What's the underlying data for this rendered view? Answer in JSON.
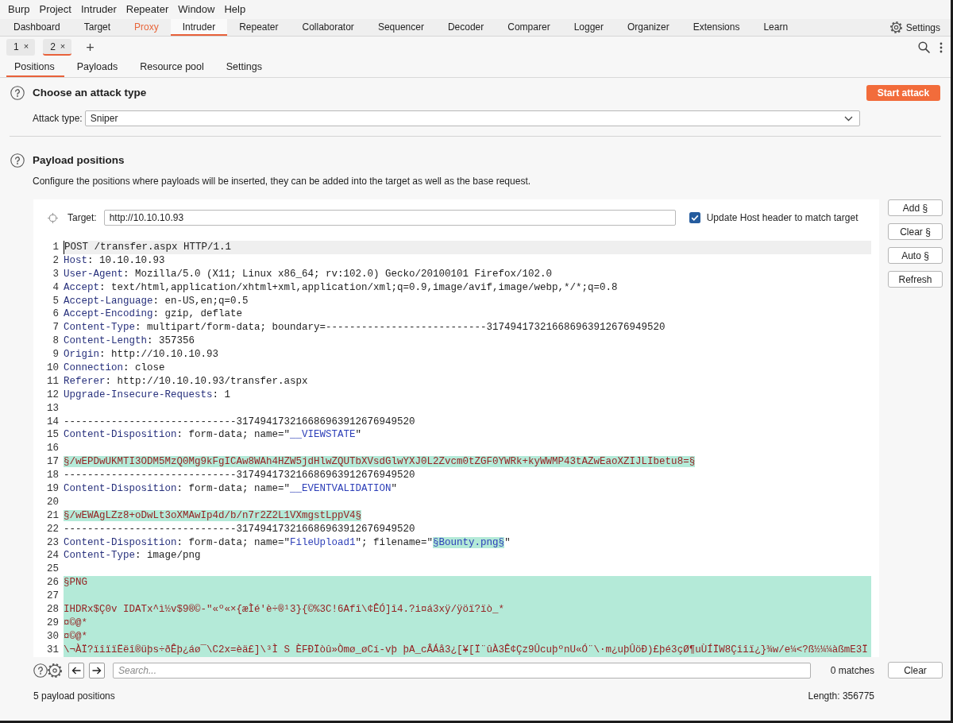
{
  "menu_bar": [
    "Burp",
    "Project",
    "Intruder",
    "Repeater",
    "Window",
    "Help"
  ],
  "main_tabs": [
    {
      "label": "Dashboard",
      "selected": false,
      "alert": false
    },
    {
      "label": "Target",
      "selected": false,
      "alert": false
    },
    {
      "label": "Proxy",
      "selected": false,
      "alert": true
    },
    {
      "label": "Intruder",
      "selected": true,
      "alert": false
    },
    {
      "label": "Repeater",
      "selected": false,
      "alert": false
    },
    {
      "label": "Collaborator",
      "selected": false,
      "alert": false
    },
    {
      "label": "Sequencer",
      "selected": false,
      "alert": false
    },
    {
      "label": "Decoder",
      "selected": false,
      "alert": false
    },
    {
      "label": "Comparer",
      "selected": false,
      "alert": false
    },
    {
      "label": "Logger",
      "selected": false,
      "alert": false
    },
    {
      "label": "Organizer",
      "selected": false,
      "alert": false
    },
    {
      "label": "Extensions",
      "selected": false,
      "alert": false
    },
    {
      "label": "Learn",
      "selected": false,
      "alert": false
    }
  ],
  "settings_button": "Settings",
  "request_tabs": [
    {
      "label": "1",
      "close": "×",
      "selected": false
    },
    {
      "label": "2",
      "close": "×",
      "selected": true
    }
  ],
  "new_tab": "+",
  "sub_tabs": [
    {
      "label": "Positions",
      "selected": true
    },
    {
      "label": "Payloads",
      "selected": false
    },
    {
      "label": "Resource pool",
      "selected": false
    },
    {
      "label": "Settings",
      "selected": false
    }
  ],
  "attack_section": {
    "title": "Choose an attack type",
    "start_button": "Start attack",
    "attack_type_label": "Attack type:",
    "attack_type": "Sniper"
  },
  "positions_section": {
    "title": "Payload positions",
    "description": "Configure the positions where payloads will be inserted, they can be added into the target as well as the base request.",
    "target_label": "Target:",
    "target": "http://10.10.10.93",
    "update_host_header": {
      "label": "Update Host header to match target",
      "checked": true
    },
    "side_buttons": [
      "Add §",
      "Clear §",
      "Auto §",
      "Refresh"
    ],
    "editor_lines": [
      {
        "number": "1",
        "current": true,
        "payload_block": false,
        "segments": [
          {
            "kind": "plain",
            "text": "POST /transfer.aspx HTTP/1.1"
          }
        ]
      },
      {
        "number": "2",
        "current": false,
        "payload_block": false,
        "segments": [
          {
            "kind": "name",
            "text": "Host"
          },
          {
            "kind": "plain",
            "text": ": 10.10.10.93"
          }
        ]
      },
      {
        "number": "3",
        "current": false,
        "payload_block": false,
        "segments": [
          {
            "kind": "name",
            "text": "User-Agent"
          },
          {
            "kind": "plain",
            "text": ": Mozilla/5.0 (X11; Linux x86_64; rv:102.0) Gecko/20100101 Firefox/102.0"
          }
        ]
      },
      {
        "number": "4",
        "current": false,
        "payload_block": false,
        "segments": [
          {
            "kind": "name",
            "text": "Accept"
          },
          {
            "kind": "plain",
            "text": ": text/html,application/xhtml+xml,application/xml;q=0.9,image/avif,image/webp,*/*;q=0.8"
          }
        ]
      },
      {
        "number": "5",
        "current": false,
        "payload_block": false,
        "segments": [
          {
            "kind": "name",
            "text": "Accept-Language"
          },
          {
            "kind": "plain",
            "text": ": en-US,en;q=0.5"
          }
        ]
      },
      {
        "number": "6",
        "current": false,
        "payload_block": false,
        "segments": [
          {
            "kind": "name",
            "text": "Accept-Encoding"
          },
          {
            "kind": "plain",
            "text": ": gzip, deflate"
          }
        ]
      },
      {
        "number": "7",
        "current": false,
        "payload_block": false,
        "segments": [
          {
            "kind": "name",
            "text": "Content-Type"
          },
          {
            "kind": "plain",
            "text": ": multipart/form-data; boundary=---------------------------317494173216686963912676949520"
          }
        ]
      },
      {
        "number": "8",
        "current": false,
        "payload_block": false,
        "segments": [
          {
            "kind": "name",
            "text": "Content-Length"
          },
          {
            "kind": "plain",
            "text": ": 357356"
          }
        ]
      },
      {
        "number": "9",
        "current": false,
        "payload_block": false,
        "segments": [
          {
            "kind": "name",
            "text": "Origin"
          },
          {
            "kind": "plain",
            "text": ": http://10.10.10.93"
          }
        ]
      },
      {
        "number": "10",
        "current": false,
        "payload_block": false,
        "segments": [
          {
            "kind": "name",
            "text": "Connection"
          },
          {
            "kind": "plain",
            "text": ": close"
          }
        ]
      },
      {
        "number": "11",
        "current": false,
        "payload_block": false,
        "segments": [
          {
            "kind": "name",
            "text": "Referer"
          },
          {
            "kind": "plain",
            "text": ": http://10.10.10.93/transfer.aspx"
          }
        ]
      },
      {
        "number": "12",
        "current": false,
        "payload_block": false,
        "segments": [
          {
            "kind": "name",
            "text": "Upgrade-Insecure-Requests"
          },
          {
            "kind": "plain",
            "text": ": 1"
          }
        ]
      },
      {
        "number": "13",
        "current": false,
        "payload_block": false
      },
      {
        "number": "14",
        "current": false,
        "payload_block": false,
        "segments": [
          {
            "kind": "plain",
            "text": "-----------------------------317494173216686963912676949520"
          }
        ]
      },
      {
        "number": "15",
        "current": false,
        "payload_block": false,
        "segments": [
          {
            "kind": "name",
            "text": "Content-Disposition"
          },
          {
            "kind": "plain",
            "text": ": form-data; name=\""
          },
          {
            "kind": "string",
            "text": "__VIEWSTATE"
          },
          {
            "kind": "plain",
            "text": "\""
          }
        ]
      },
      {
        "number": "16",
        "current": false,
        "payload_block": false
      },
      {
        "number": "17",
        "current": false,
        "payload_block": false,
        "segments": [
          {
            "kind": "payload",
            "text": "§/wEPDwUKMTI3ODM5MzQ0Mg9kFgICAw8WAh4HZW5jdHlwZQUTbXVsdGlwYXJ0L2Zvcm0tZGF0YWRk+kyWWMP43tAZwEaoXZIJLIbetu8=§"
          }
        ]
      },
      {
        "number": "18",
        "current": false,
        "payload_block": false,
        "segments": [
          {
            "kind": "plain",
            "text": "-----------------------------317494173216686963912676949520"
          }
        ]
      },
      {
        "number": "19",
        "current": false,
        "payload_block": false,
        "segments": [
          {
            "kind": "name",
            "text": "Content-Disposition"
          },
          {
            "kind": "plain",
            "text": ": form-data; name=\""
          },
          {
            "kind": "string",
            "text": "__EVENTVALIDATION"
          },
          {
            "kind": "plain",
            "text": "\""
          }
        ]
      },
      {
        "number": "20",
        "current": false,
        "payload_block": false
      },
      {
        "number": "21",
        "current": false,
        "payload_block": false,
        "segments": [
          {
            "kind": "payload",
            "text": "§/wEWAgLZz8+oDwLt3oXMAwIp4d/b/n7r2Z2L1VXmgstLppV4§"
          }
        ]
      },
      {
        "number": "22",
        "current": false,
        "payload_block": false,
        "segments": [
          {
            "kind": "plain",
            "text": "-----------------------------317494173216686963912676949520"
          }
        ]
      },
      {
        "number": "23",
        "current": false,
        "payload_block": false,
        "segments": [
          {
            "kind": "name",
            "text": "Content-Disposition"
          },
          {
            "kind": "plain",
            "text": ": form-data; name=\""
          },
          {
            "kind": "string",
            "text": "FileUpload1"
          },
          {
            "kind": "plain",
            "text": "\"; filename=\""
          },
          {
            "kind": "payload_string",
            "text": "§Bounty.png§"
          },
          {
            "kind": "plain",
            "text": "\""
          }
        ]
      },
      {
        "number": "24",
        "current": false,
        "payload_block": false,
        "segments": [
          {
            "kind": "name",
            "text": "Content-Type"
          },
          {
            "kind": "plain",
            "text": ": image/png"
          }
        ]
      },
      {
        "number": "25",
        "current": false,
        "payload_block": false
      },
      {
        "number": "26",
        "current": false,
        "payload_block": true,
        "segments": [
          {
            "kind": "payload",
            "text": "§PNG"
          }
        ]
      },
      {
        "number": "27",
        "current": false,
        "payload_block": true
      },
      {
        "number": "28",
        "current": false,
        "payload_block": true,
        "segments": [
          {
            "kind": "payload",
            "text": "IHDRx$Ç0v IDATx^ì½v$9®©-\"«º«×{æÌé'è÷®¹3}{©%3C!6Afî\\¢ÊÓ]î4.?i¤á3xÿ/ÿöï?ïò_*"
          }
        ]
      },
      {
        "number": "29",
        "current": false,
        "payload_block": true,
        "segments": [
          {
            "kind": "payload",
            "text": "¤©@*"
          }
        ]
      },
      {
        "number": "30",
        "current": false,
        "payload_block": true,
        "segments": [
          {
            "kind": "payload",
            "text": "¤©@*"
          }
        ]
      },
      {
        "number": "31",
        "current": false,
        "payload_block": true,
        "segments": [
          {
            "kind": "payload",
            "text": "\\¬ÀÏ?ïîïïËëî®üþs÷ðÊþ¿áø¯\\C2x=èä£]\\³Ì S ÈFÐÏòû»Òmø_øCí-vþ þA_cÂÁå3¿[¥[Ï¨ûÀ3Ê¢Çz9ÛcuþºnU«Ó¨\\·m¿uþÛöÐ)£þé3çØ¶uÙÍÏW8Çîîï¿}¾w/e¼<?ß½¼¼àßmE3Ï"
          }
        ]
      }
    ]
  },
  "search_bar": {
    "placeholder": "Search...",
    "matches": "0 matches",
    "clear_button": "Clear"
  },
  "status_bar": {
    "payload_positions": "5 payload positions",
    "length": "Length: 356775"
  }
}
